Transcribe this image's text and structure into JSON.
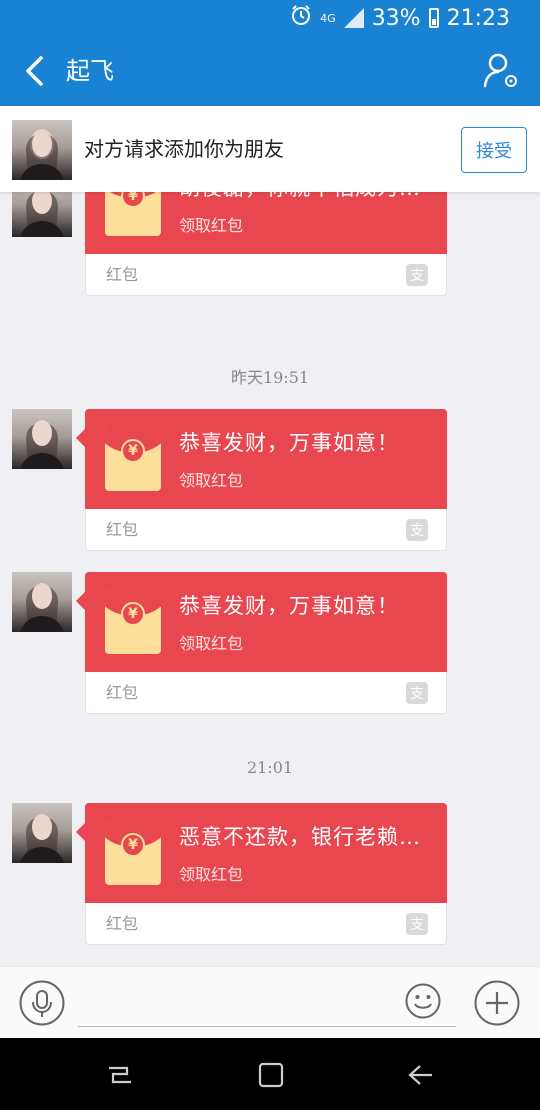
{
  "status_bar": {
    "network": "4G",
    "battery": "33%",
    "time": "21:23"
  },
  "nav": {
    "title": "起飞"
  },
  "friend_request": {
    "text": "对方请求添加你为朋友",
    "accept_label": "接受"
  },
  "messages": [
    {
      "title": "胡俊磊，你就不怕成为失信人吗",
      "subtitle": "领取红包",
      "footer": "红包"
    },
    {
      "title": "恭喜发财，万事如意！",
      "subtitle": "领取红包",
      "footer": "红包"
    },
    {
      "title": "恭喜发财，万事如意！",
      "subtitle": "领取红包",
      "footer": "红包"
    },
    {
      "title": "恶意不还款，银行老赖了？",
      "subtitle": "领取红包",
      "footer": "红包"
    }
  ],
  "timestamps": [
    "昨天19:51",
    "21:01"
  ],
  "colors": {
    "primary": "#1a82d2",
    "packet_red": "#e8474f",
    "envelope_gold": "#fcdf9b",
    "chat_bg": "#efeff4"
  }
}
